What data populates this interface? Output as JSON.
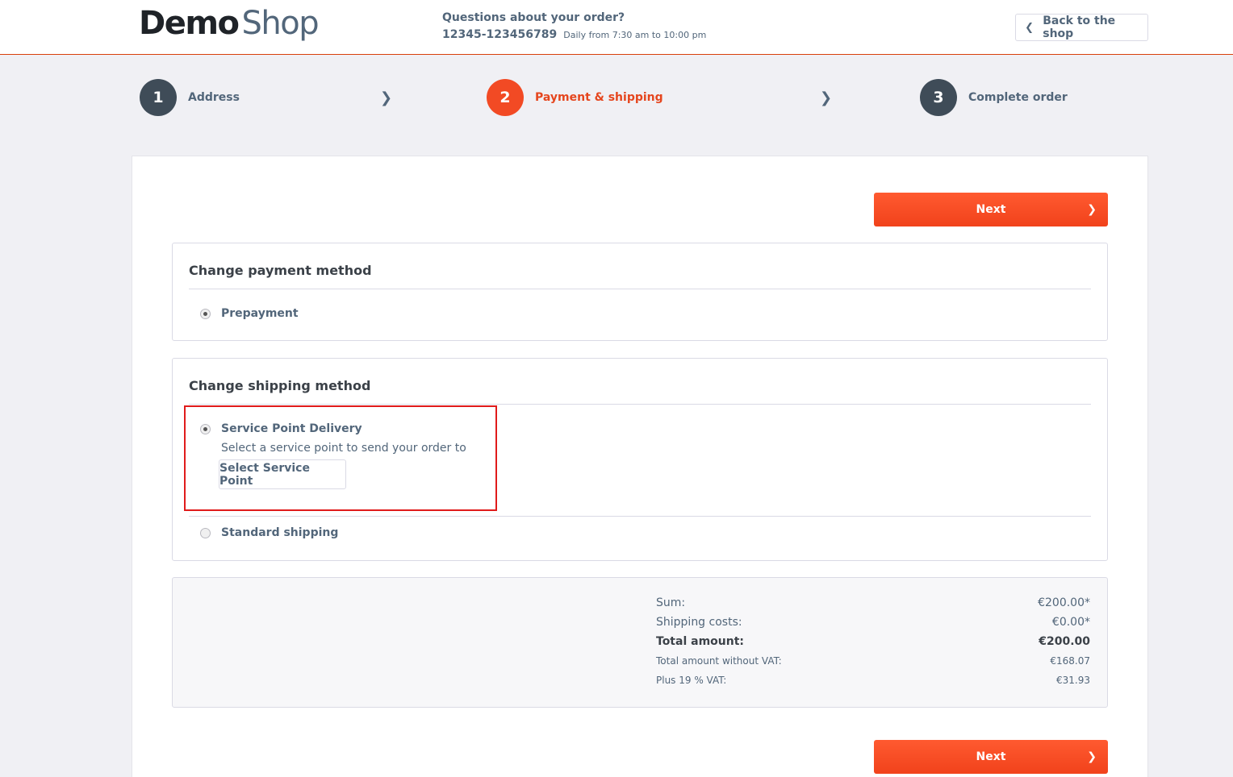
{
  "header": {
    "logo_bold": "Demo",
    "logo_light": "Shop",
    "hotline_question": "Questions about your order?",
    "hotline_phone": "12345-123456789",
    "hotline_hours": "Daily from 7:30 am to 10:00 pm",
    "back_label": "Back to the shop"
  },
  "steps": [
    {
      "num": "1",
      "label": "Address"
    },
    {
      "num": "2",
      "label": "Payment & shipping"
    },
    {
      "num": "3",
      "label": "Complete order"
    }
  ],
  "next_label": "Next",
  "payment": {
    "title": "Change payment method",
    "options": [
      {
        "label": "Prepayment",
        "checked": true
      }
    ]
  },
  "shipping": {
    "title": "Change shipping method",
    "options": [
      {
        "label": "Service Point Delivery",
        "checked": true,
        "description": "Select a service point to send your order to",
        "button_label": "Select Service Point"
      },
      {
        "label": "Standard shipping",
        "checked": false
      }
    ]
  },
  "summary": {
    "rows": [
      {
        "label": "Sum:",
        "value": "€200.00*"
      },
      {
        "label": "Shipping costs:",
        "value": "€0.00*"
      },
      {
        "label": "Total amount:",
        "value": "€200.00"
      },
      {
        "label": "Total amount without VAT:",
        "value": "€168.07"
      },
      {
        "label": "Plus 19 % VAT:",
        "value": "€31.93"
      }
    ]
  },
  "colors": {
    "accent": "#f24a24",
    "step_dark": "#3f4c58",
    "highlight_border": "#e01b1b"
  }
}
